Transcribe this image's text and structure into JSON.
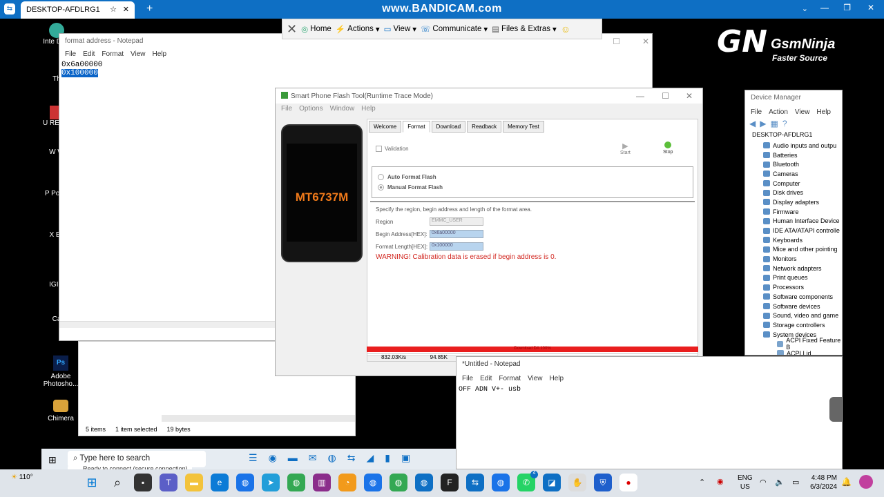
{
  "teamviewer": {
    "tab_title": "DESKTOP-AFDLRG1",
    "watermark": "www.BANDICAM.com",
    "toolbar": [
      "Home",
      "Actions",
      "View",
      "Communicate",
      "Files & Extras"
    ]
  },
  "desktop_icons": [
    "Inte Dow",
    "Th",
    "U REDIF",
    "W W",
    "P Powe",
    "X Ex",
    "IGI 2",
    "Ca",
    "Adobe Photosho...",
    "Chimera"
  ],
  "brand": {
    "logo": "GN",
    "name": "GsmNinja",
    "tagline": "Faster Source"
  },
  "notepad1": {
    "title": "format address - Notepad",
    "menu": [
      "File",
      "Edit",
      "Format",
      "View",
      "Help"
    ],
    "lines": [
      "0x6a00000",
      "0x100000"
    ]
  },
  "flashtool": {
    "title": "Smart Phone Flash Tool(Runtime Trace Mode)",
    "menu": [
      "File",
      "Options",
      "Window",
      "Help"
    ],
    "phone_label": "MT6737M",
    "tabs": [
      "Welcome",
      "Format",
      "Download",
      "Readback",
      "Memory Test"
    ],
    "validation": "Validation",
    "start": "Start",
    "stop": "Stop",
    "auto": "Auto Format Flash",
    "manual": "Manual Format Flash",
    "specify": "Specify the region, begin address and length of the format area.",
    "region_label": "Region",
    "region_value": "EMMC_USER",
    "begin_label": "Begin Address[HEX]:",
    "begin_value": "0x6a00000",
    "length_label": "Format Length[HEX]:",
    "length_value": "0x100000",
    "warning": "WARNING! Calibration data is erased if begin address is 0.",
    "progress_text": "Download DA 100%",
    "speed": "832.03K/s",
    "size": "94.85K"
  },
  "explorer": {
    "items": "5 items",
    "selected": "1 item selected",
    "bytes": "19 bytes"
  },
  "notepad2": {
    "title": "*Untitled - Notepad",
    "menu": [
      "File",
      "Edit",
      "Format",
      "View",
      "Help"
    ],
    "text": "OFF ADN V+- usb"
  },
  "devmgr": {
    "title": "Device Manager",
    "menu": [
      "File",
      "Action",
      "View",
      "Help"
    ],
    "root": "DESKTOP-AFDLRG1",
    "items": [
      "Audio inputs and outpu",
      "Batteries",
      "Bluetooth",
      "Cameras",
      "Computer",
      "Disk drives",
      "Display adapters",
      "Firmware",
      "Human Interface Device",
      "IDE ATA/ATAPI controlle",
      "Keyboards",
      "Mice and other pointing",
      "Monitors",
      "Network adapters",
      "Print queues",
      "Processors",
      "Software components",
      "Software devices",
      "Sound, video and game",
      "Storage controllers",
      "System devices"
    ],
    "sub": [
      "ACPI Fixed Feature B",
      "ACPI Lid"
    ]
  },
  "inner_taskbar": {
    "search": "Type here to search",
    "status": "Ready to connect (secure connection)"
  },
  "taskbar": {
    "weather": "110°",
    "lang1": "ENG",
    "lang2": "US",
    "time": "4:48 PM",
    "date": "6/3/2024",
    "badge1": "4"
  }
}
